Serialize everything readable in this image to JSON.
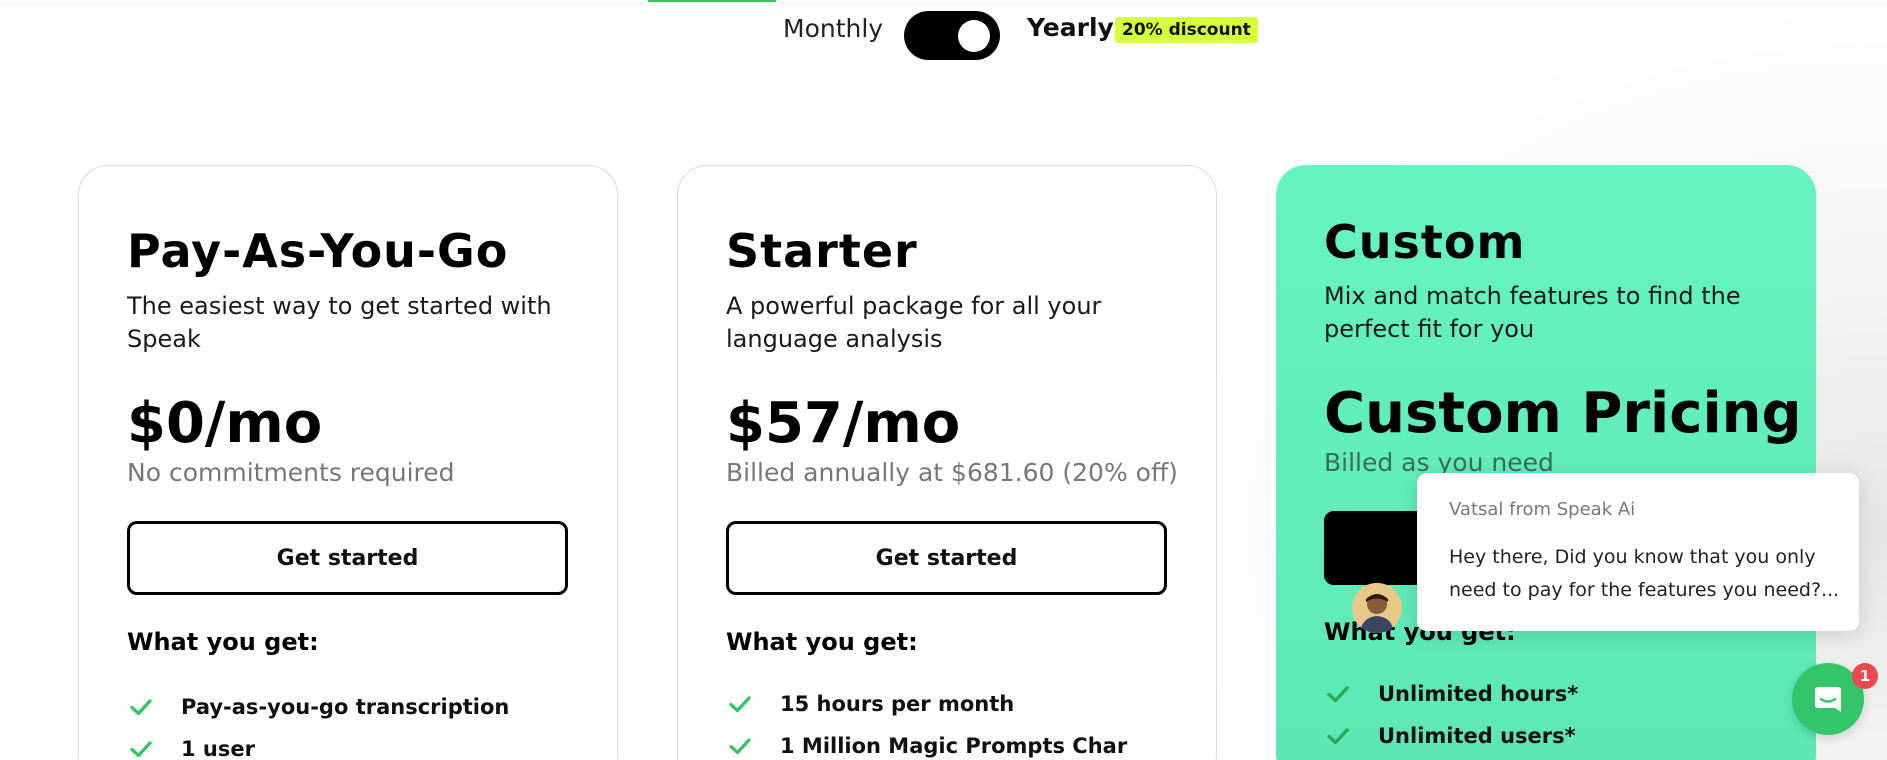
{
  "billing": {
    "monthly_label": "Monthly",
    "yearly_label": "Yearly",
    "discount_badge": "20% discount",
    "selected": "Yearly"
  },
  "plans": [
    {
      "name": "Pay-As-You-Go",
      "description": "The easiest way to get started with Speak",
      "price": "$0/mo",
      "price_note": "No commitments required",
      "cta": "Get started",
      "features_heading": "What you get:",
      "features": [
        "Pay-as-you-go transcription",
        "1 user"
      ]
    },
    {
      "name": "Starter",
      "description": "A powerful package for all your language analysis",
      "price": "$57/mo",
      "price_note": "Billed annually at $681.60 (20% off)",
      "cta": "Get started",
      "features_heading": "What you get:",
      "features": [
        "15 hours per month",
        "1 Million Magic Prompts Char"
      ]
    },
    {
      "name": "Custom",
      "description": "Mix and match features to find the perfect fit for you",
      "price": "Custom Pricing",
      "price_note": "Billed as you need",
      "cta": "",
      "features_heading": "What you get:",
      "features": [
        "Unlimited hours*",
        "Unlimited users*"
      ]
    }
  ],
  "chat": {
    "sender": "Vatsal from Speak Ai",
    "message": "Hey there, Did you know that you only need to pay for the features you need?...",
    "unread_count": "1"
  },
  "colors": {
    "accent_green": "#34c46a",
    "custom_card": "#66f4c2",
    "discount_badge": "#d6ff3c",
    "notification": "#f0484f"
  },
  "icons": {
    "feature_check": "check-icon",
    "chat_launcher": "chat-bubble-icon"
  }
}
